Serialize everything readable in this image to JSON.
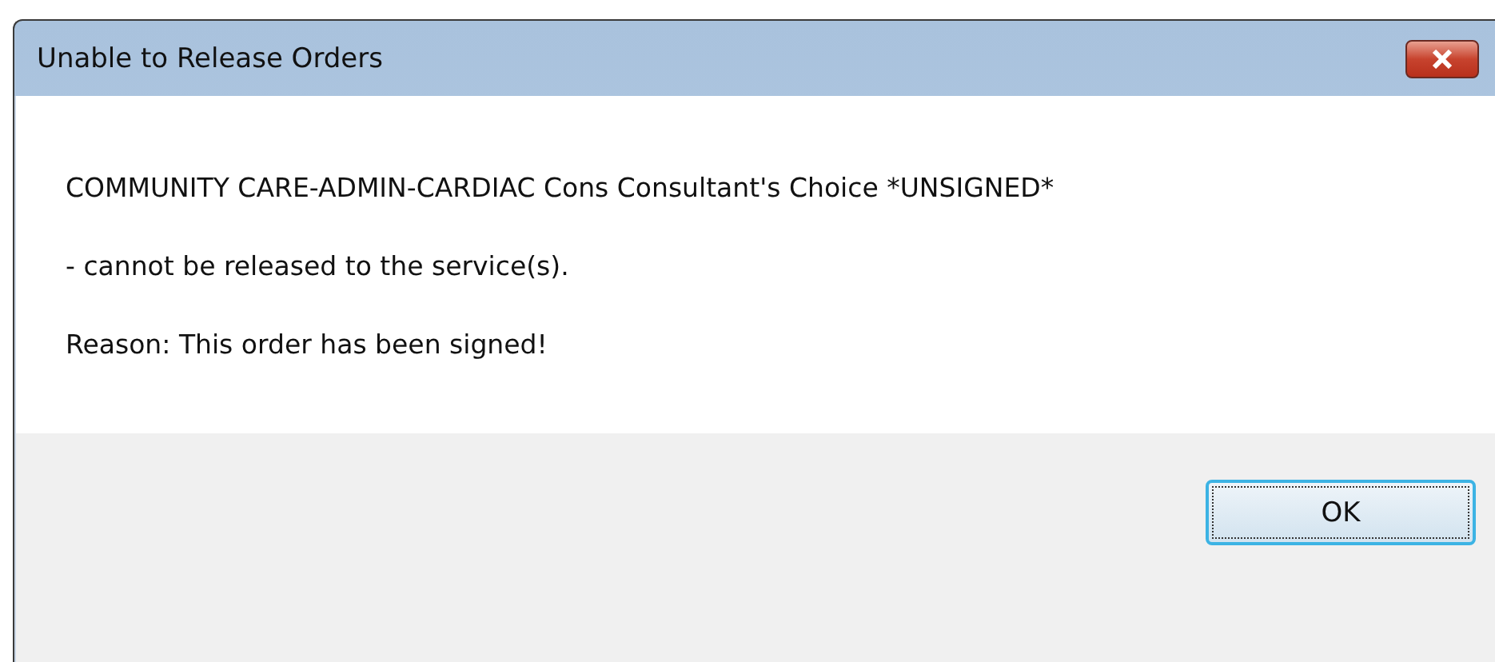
{
  "window": {
    "title": "Unable to Release Orders"
  },
  "message": [
    "COMMUNITY CARE-ADMIN-CARDIAC Cons Consultant's Choice *UNSIGNED*",
    "- cannot be released to the service(s).",
    "Reason: This order has been signed!"
  ],
  "buttons": [
    {
      "label": "OK",
      "selected": true
    }
  ]
}
